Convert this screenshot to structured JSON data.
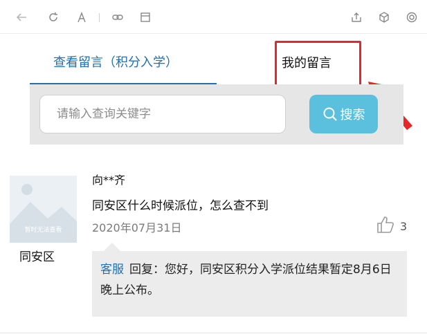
{
  "toolbar": {
    "left_icons": [
      "back-arrow-icon",
      "refresh-icon",
      "font-icon",
      "link-icon",
      "window-icon"
    ],
    "right_icons": [
      "share-icon",
      "cube-icon",
      "settings-icon"
    ]
  },
  "tabs": {
    "view": "查看留言（积分入学）",
    "mine": "我的留言"
  },
  "search": {
    "placeholder": "请输入查询关键字",
    "button_label": "搜索"
  },
  "message": {
    "avatar_caption": "暂时无法查看",
    "district": "同安区",
    "username": "向**齐",
    "question": "同安区什么时候派位，怎么查不到",
    "date": "2020年07月31日",
    "likes": "3",
    "reply_author": "客服",
    "reply_text": "回复：您好，同安区积分入学派位结果暂定8月6日晚上公布。"
  },
  "colors": {
    "accent": "#1f6fb2",
    "search_button": "#5bc0de",
    "annotation_red": "#e8262a"
  }
}
